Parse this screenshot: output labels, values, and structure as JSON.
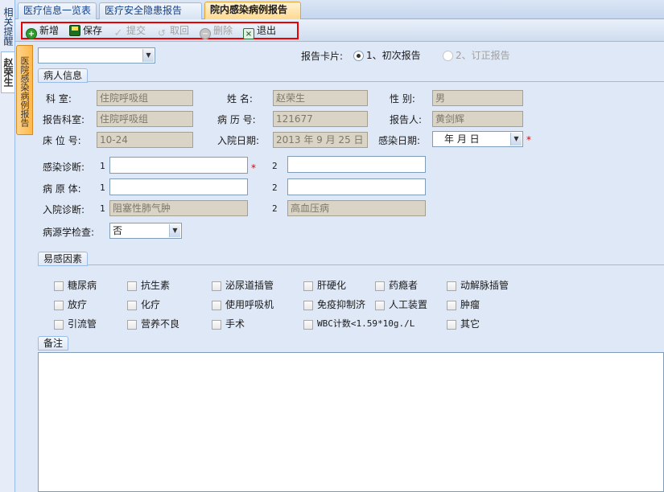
{
  "left_tabs": {
    "related": "相关提醒",
    "patient": "赵荣生"
  },
  "tabs": [
    "医疗信息一览表",
    "医疗安全隐患报告",
    "院内感染病例报告"
  ],
  "toolbar": {
    "add": "新增",
    "save": "保存",
    "submit": "提交",
    "retract": "取回",
    "delete": "删除",
    "exit": "退出"
  },
  "side_tab": "医院感染病例报告",
  "top": {
    "select_value": "",
    "card_label": "报告卡片:",
    "radio1": "1、初次报告",
    "radio2": "2、订正报告",
    "radio1_checked": true
  },
  "patient": {
    "section": "病人信息",
    "dept_label": "科    室:",
    "dept": "住院呼吸组",
    "name_label": "姓    名:",
    "name": "赵荣生",
    "gender_label": "性    别:",
    "gender": "男",
    "rdept_label": "报告科室:",
    "rdept": "住院呼吸组",
    "record_label": "病 历 号:",
    "record": "121677",
    "reporter_label": "报告人:",
    "reporter": "黄剑辉",
    "bed_label": "床 位 号:",
    "bed": "10-24",
    "admit_label": "入院日期:",
    "admit": "2013 年 9 月 25 日",
    "infect_date_label": "感染日期:",
    "infect_date": "年   月   日",
    "diag_label": "感染诊断:",
    "diag1": "",
    "diag2": "",
    "pathogen_label": "病 原 体:",
    "path1": "",
    "path2": "",
    "admit_diag_label": "入院诊断:",
    "ad1": "阻塞性肺气肿",
    "ad2": "高血压病",
    "etiology_label": "病源学检查:",
    "etiology": "否",
    "n1": "1",
    "n2": "2"
  },
  "risk": {
    "section": "易感因素",
    "items": [
      "糖尿病",
      "抗生素",
      "泌尿道插管",
      "肝硬化",
      "药瘾者",
      "动解脉插管",
      "放疗",
      "化疗",
      "使用呼吸机",
      "免疫抑制济",
      "人工装置",
      "肿瘤",
      "引流管",
      "营养不良",
      "手术",
      "WBC计数<1.59*10g./L",
      "其它"
    ]
  },
  "remarks": {
    "section": "备注",
    "text": ""
  }
}
